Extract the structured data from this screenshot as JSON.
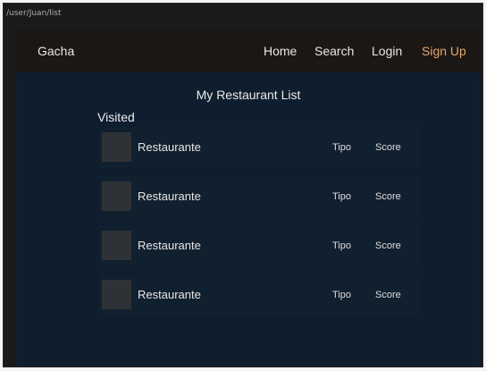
{
  "browser": {
    "url_path": "/user/Juan/list"
  },
  "navbar": {
    "brand": "Gacha",
    "links": {
      "home": "Home",
      "search": "Search",
      "login": "Login",
      "signup": "Sign Up"
    },
    "signup_color": "#e8a56b"
  },
  "main": {
    "title": "My Restaurant List",
    "section_title": "Visited",
    "rows": [
      {
        "name": "Restaurante",
        "type": "Tipo",
        "score": "Score"
      },
      {
        "name": "Restaurante",
        "type": "Tipo",
        "score": "Score"
      },
      {
        "name": "Restaurante",
        "type": "Tipo",
        "score": "Score"
      },
      {
        "name": "Restaurante",
        "type": "Tipo",
        "score": "Score"
      }
    ]
  },
  "colors": {
    "page_background": "#0f1e2f",
    "navbar_background": "#1a1714",
    "accent": "#e8a56b"
  }
}
